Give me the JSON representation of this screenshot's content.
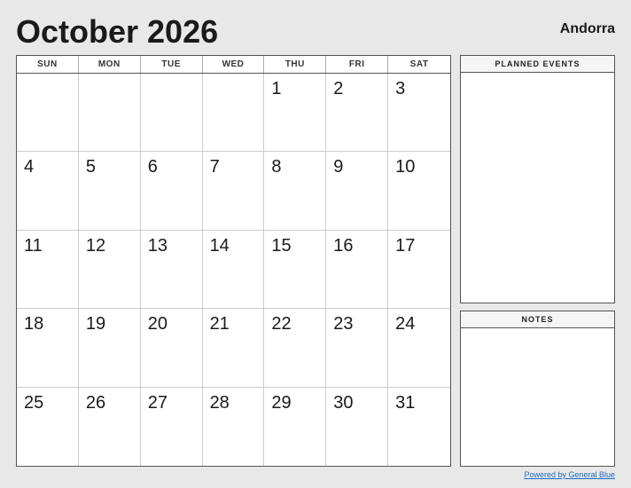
{
  "header": {
    "title": "October 2026",
    "location": "Andorra"
  },
  "calendar": {
    "days_of_week": [
      "SUN",
      "MON",
      "TUE",
      "WED",
      "THU",
      "FRI",
      "SAT"
    ],
    "weeks": [
      [
        "",
        "",
        "",
        "",
        "1",
        "2",
        "3"
      ],
      [
        "4",
        "5",
        "6",
        "7",
        "8",
        "9",
        "10"
      ],
      [
        "11",
        "12",
        "13",
        "14",
        "15",
        "16",
        "17"
      ],
      [
        "18",
        "19",
        "20",
        "21",
        "22",
        "23",
        "24"
      ],
      [
        "25",
        "26",
        "27",
        "28",
        "29",
        "30",
        "31"
      ]
    ]
  },
  "sidebar": {
    "planned_events_label": "PLANNED EVENTS",
    "notes_label": "NOTES"
  },
  "footer": {
    "powered_by": "Powered by General Blue"
  }
}
